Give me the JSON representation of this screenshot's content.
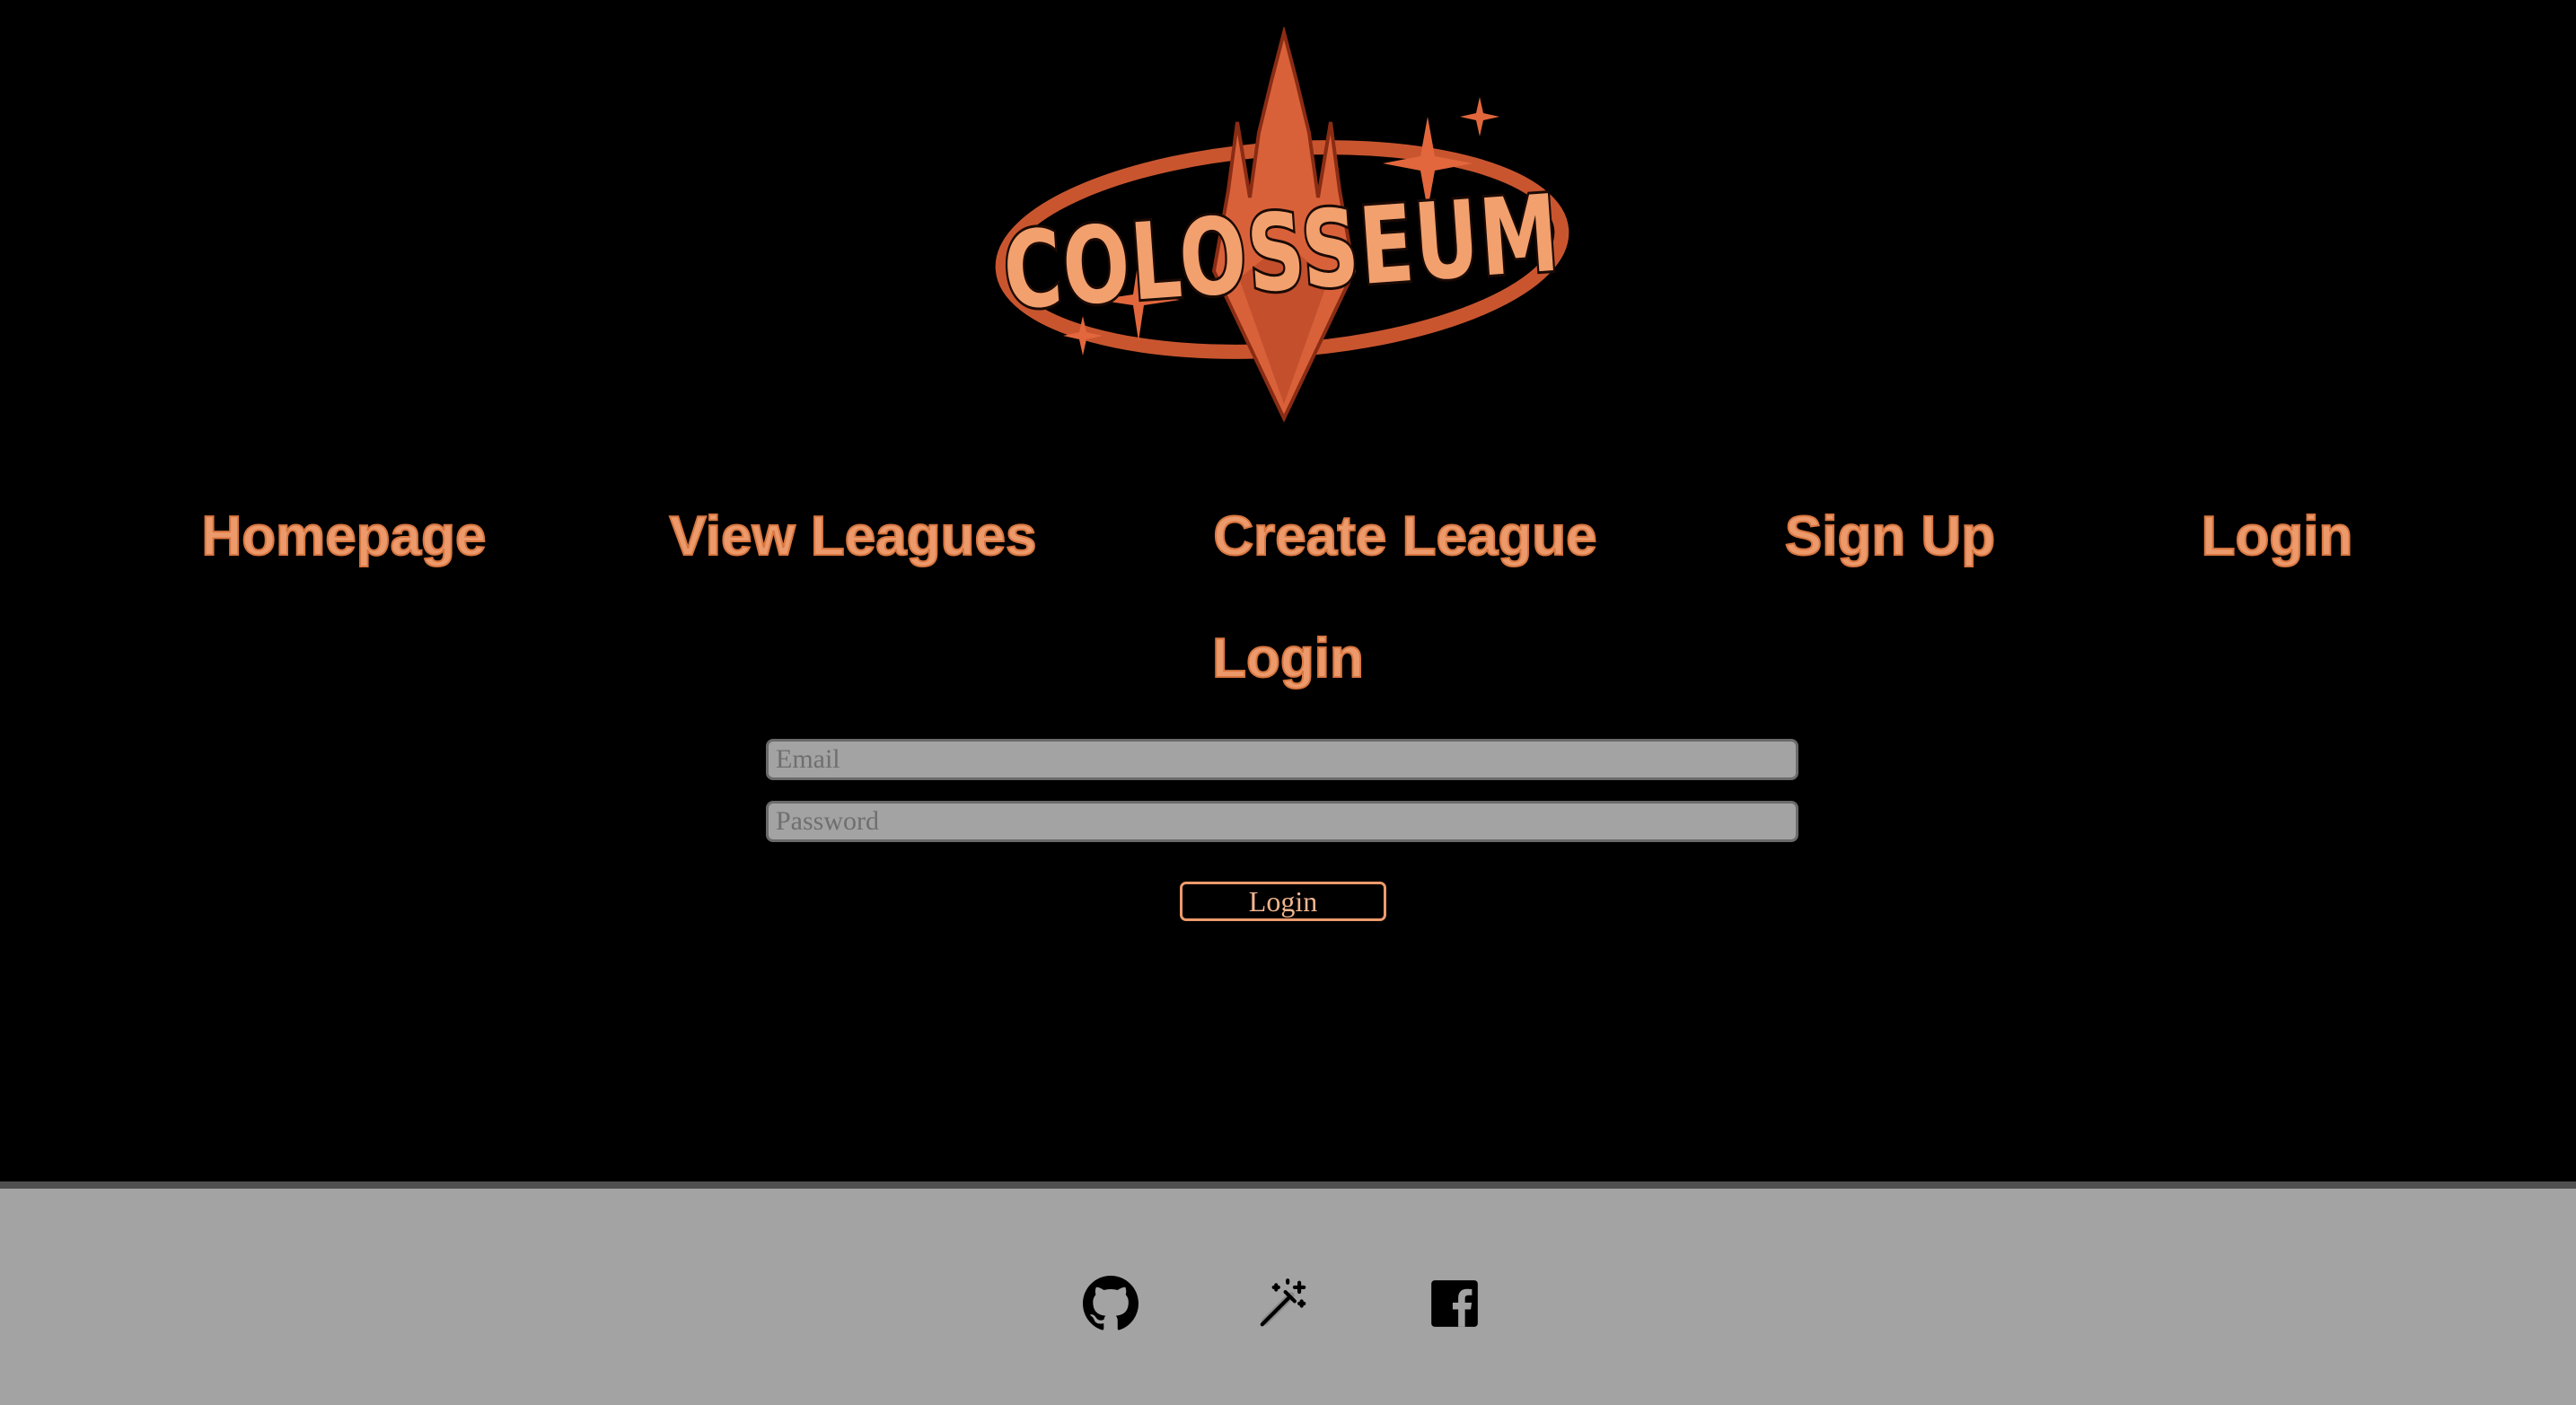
{
  "brand": {
    "logo_text": "COLOSSEUM"
  },
  "nav": {
    "items": [
      {
        "label": "Homepage"
      },
      {
        "label": "View Leagues"
      },
      {
        "label": "Create League"
      },
      {
        "label": "Sign Up"
      },
      {
        "label": "Login"
      }
    ]
  },
  "login_form": {
    "heading": "Login",
    "email_placeholder": "Email",
    "password_placeholder": "Password",
    "submit_label": "Login"
  },
  "footer": {
    "icons": [
      "github-icon",
      "magic-wand-icon",
      "facebook-icon"
    ]
  },
  "colors": {
    "accent": "#ec9a6c",
    "logo_orange": "#e2673d",
    "background": "#000000",
    "footer_bg": "#a3a3a3",
    "input_bg": "#a3a3a3"
  }
}
